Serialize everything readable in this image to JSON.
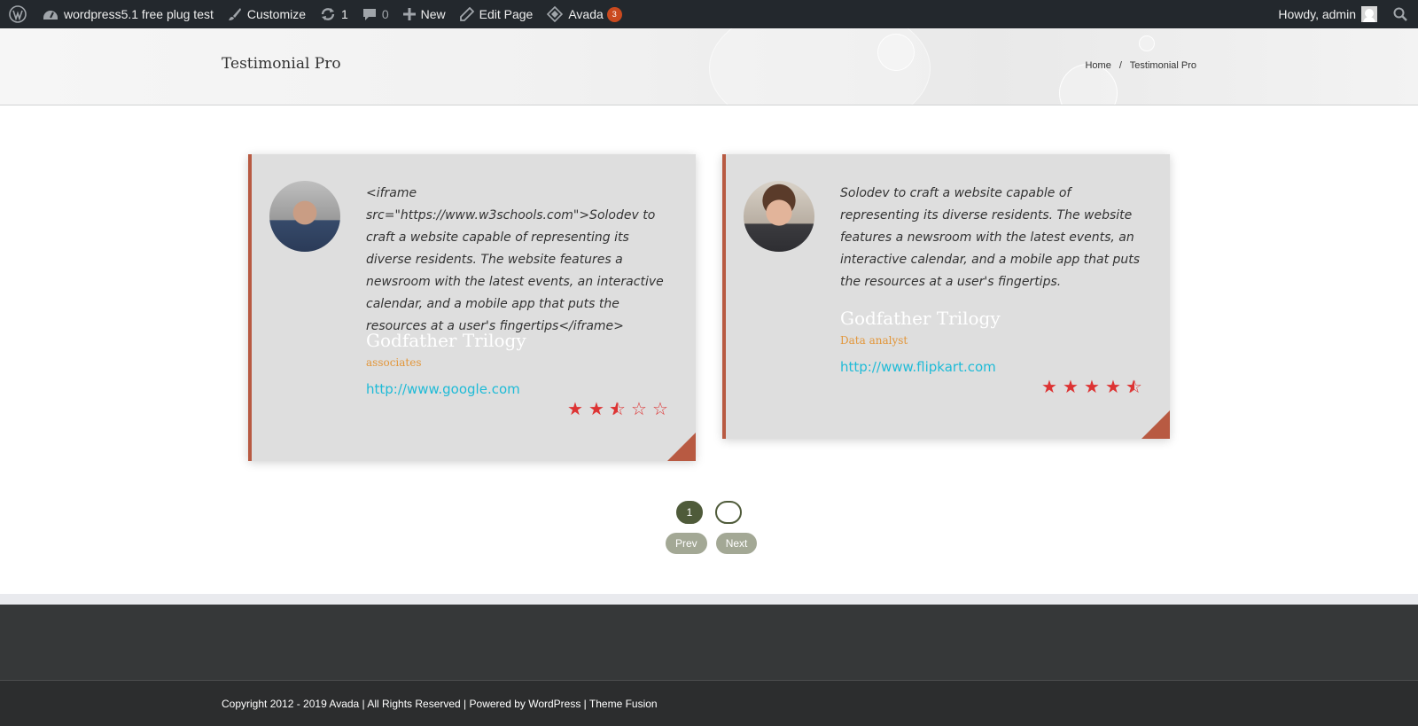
{
  "adminbar": {
    "site_name": "wordpress5.1 free plug test",
    "customize": "Customize",
    "updates_count": "1",
    "comments_count": "0",
    "new_label": "New",
    "edit_page": "Edit Page",
    "avada": "Avada",
    "avada_badge": "3",
    "howdy": "Howdy, admin"
  },
  "titlebar": {
    "title": "Testimonial Pro",
    "breadcrumbs": {
      "home": "Home",
      "separator": "/",
      "current": "Testimonial Pro"
    }
  },
  "testimonials": [
    {
      "text": "<iframe src=\"https://www.w3schools.com\">Solodev to craft a website capable of representing its diverse residents. The website features a newsroom with the latest events, an interactive calendar, and a mobile app that puts the resources at a user's fingertips</iframe>",
      "name": "Godfather Trilogy",
      "position": "associates",
      "website": "http://www.google.com",
      "rating": 2.5,
      "rating_max": 5
    },
    {
      "text": "Solodev to craft a website capable of representing its diverse residents. The website features a newsroom with the latest events, an interactive calendar, and a mobile app that puts the resources at a user's fingertips.",
      "name": "Godfather Trilogy",
      "position": "Data analyst",
      "website": "http://www.flipkart.com",
      "rating": 4.5,
      "rating_max": 5
    }
  ],
  "pagination": {
    "current_page": "1",
    "prev": "Prev",
    "next": "Next"
  },
  "footer": {
    "copyright": "Copyright 2012 - 2019 Avada | All Rights Reserved | Powered by WordPress | Theme Fusion"
  },
  "colors": {
    "accent": "#b85a42",
    "star": "#dd3333",
    "link": "#1ebbd7",
    "position": "#e2963a",
    "pagination": "#4f5b3a"
  }
}
